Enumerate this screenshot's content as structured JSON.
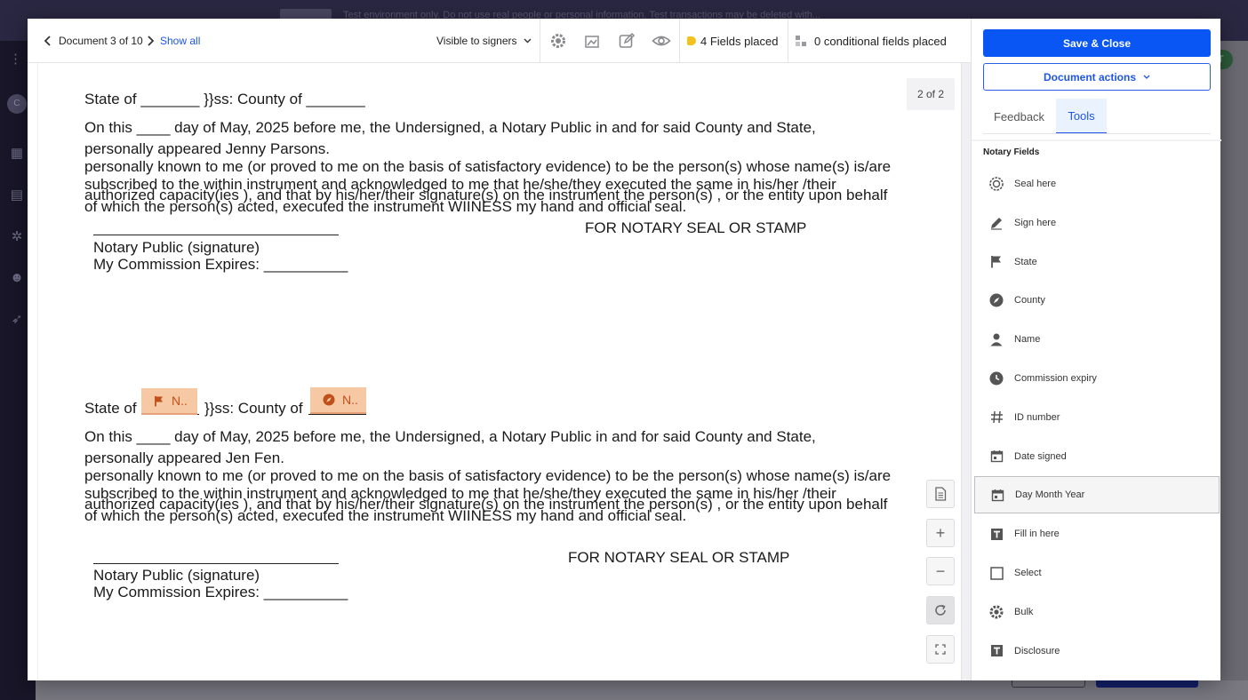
{
  "background": {
    "banner_label": "FABIAN",
    "banner_text": "Test environment only. Do not use real people or personal information. Test transactions may be deleted with...",
    "avatar_initial": "C",
    "right_initials": "T"
  },
  "toolbar": {
    "document_label": "Document 3 of 10",
    "show_all": "Show all",
    "visibility": "Visible to signers",
    "fields_placed": "4 Fields placed",
    "conditional_placed": "0 conditional fields placed"
  },
  "document": {
    "page_badge": "2 of 2",
    "block1": {
      "state_line": "State of _______ }}ss: County of _______",
      "line1": "On this ____ day of May, 2025 before me, the Undersigned, a Notary Public in and for said County and State,",
      "line2": "personally appeared Jenny Parsons.",
      "line3": "personally known to me (or proved to me on the basis of satisfactory evidence) to be the person(s) whose name(s) is/are",
      "line4": "subscribed to the within instrument and acknowledged to me that he/she/they executed the same in his/her /their",
      "line5": "authorized  capacity(ies ), and that by his/her/their signature(s) on the instrument the person(s) , or the entity upon behalf",
      "line6": "of which the person(s) acted, executed the instrument WIINESS my hand and official seal.",
      "seal_label": "FOR NOTARY SEAL OR STAMP",
      "sig_label": "Notary Public (signature)",
      "commission": "My Commission Expires: __________"
    },
    "block2": {
      "state_prefix": "State of",
      "state_mid": "}}ss: County of",
      "field_state": "N..",
      "field_county": "N..",
      "line1": "On this ____ day of May, 2025 before me, the Undersigned, a Notary Public in and for said County and State,",
      "line2": "personally appeared Jen Fen.",
      "line3": "personally known to me (or proved to me on the basis of satisfactory evidence) to be the person(s) whose name(s) is/are",
      "line4": "subscribed to the within instrument and acknowledged to me that he/she/they executed the same in his/her /their",
      "line5": "authorized  capacity(ies ), and that by his/her/their signature(s) on the instrument the person(s) , or the entity upon behalf",
      "line6": "of which the person(s) acted, executed the instrument WIINESS my hand and official seal.",
      "seal_label": "FOR NOTARY SEAL OR STAMP",
      "sig_label": "Notary Public (signature)",
      "commission": "My Commission Expires: __________"
    }
  },
  "panel": {
    "save_close": "Save & Close",
    "document_actions": "Document actions",
    "tabs": [
      "Feedback",
      "Tools"
    ],
    "section_title": "Notary Fields",
    "tools": [
      {
        "label": "Seal here",
        "icon": "seal-icon"
      },
      {
        "label": "Sign here",
        "icon": "pen-icon"
      },
      {
        "label": "State",
        "icon": "flag-icon"
      },
      {
        "label": "County",
        "icon": "compass-icon"
      },
      {
        "label": "Name",
        "icon": "person-icon"
      },
      {
        "label": "Commission expiry",
        "icon": "clock-icon"
      },
      {
        "label": "ID number",
        "icon": "hash-icon"
      },
      {
        "label": "Date signed",
        "icon": "calendar-icon"
      },
      {
        "label": "Day Month Year",
        "icon": "calendar-icon"
      },
      {
        "label": "Fill in here",
        "icon": "text-box-icon"
      },
      {
        "label": "Select",
        "icon": "checkbox-icon"
      },
      {
        "label": "Bulk",
        "icon": "bulk-gear-icon"
      },
      {
        "label": "Disclosure",
        "icon": "text-box-icon"
      }
    ]
  },
  "colors": {
    "primary": "#0a56f5",
    "field_fill": "#f6c9a4",
    "field_text": "#c0501a",
    "fields_dot": "#f2c21b"
  }
}
